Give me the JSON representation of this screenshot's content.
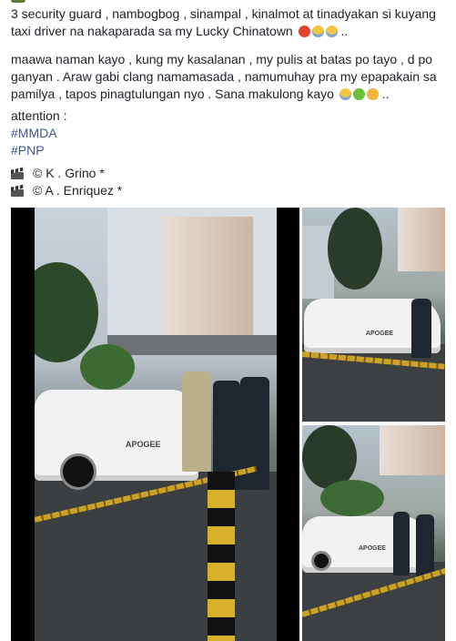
{
  "post": {
    "line1": "3 security guard , nambogbog , sinampal , kinalmot at tinadyakan si kuyang",
    "line2": "taxi driver na nakaparada sa my Lucky Chinatown",
    "line2_suffix": " ..",
    "line3": "maawa naman kayo , kung my kasalanan , my pulis at batas po tayo , d po",
    "line4": "ganyan . Araw gabi clang namamasada , namumuhay pra my epapakain sa",
    "line5": "pamilya , tapos pinagtulungan nyo . Sana makulong kayo",
    "line5_suffix": " ..",
    "attention": "attention :",
    "hashtags": [
      "#MMDA",
      "#PNP"
    ],
    "credits": [
      "© K . Grino *",
      "© A . Enriquez *"
    ],
    "line2_emojis": [
      "angry-face-icon",
      "screaming-face-icon",
      "screaming-face-icon"
    ],
    "line5_emojis": [
      "screaming-face-icon",
      "nauseated-face-icon",
      "persevering-face-icon"
    ]
  },
  "media": {
    "main_car_logo": "APOGEE",
    "thumb1_car_logo": "APOGEE",
    "thumb2_car_logo": "APOGEE"
  },
  "colors": {
    "link": "#385898",
    "text": "#1d2129"
  }
}
